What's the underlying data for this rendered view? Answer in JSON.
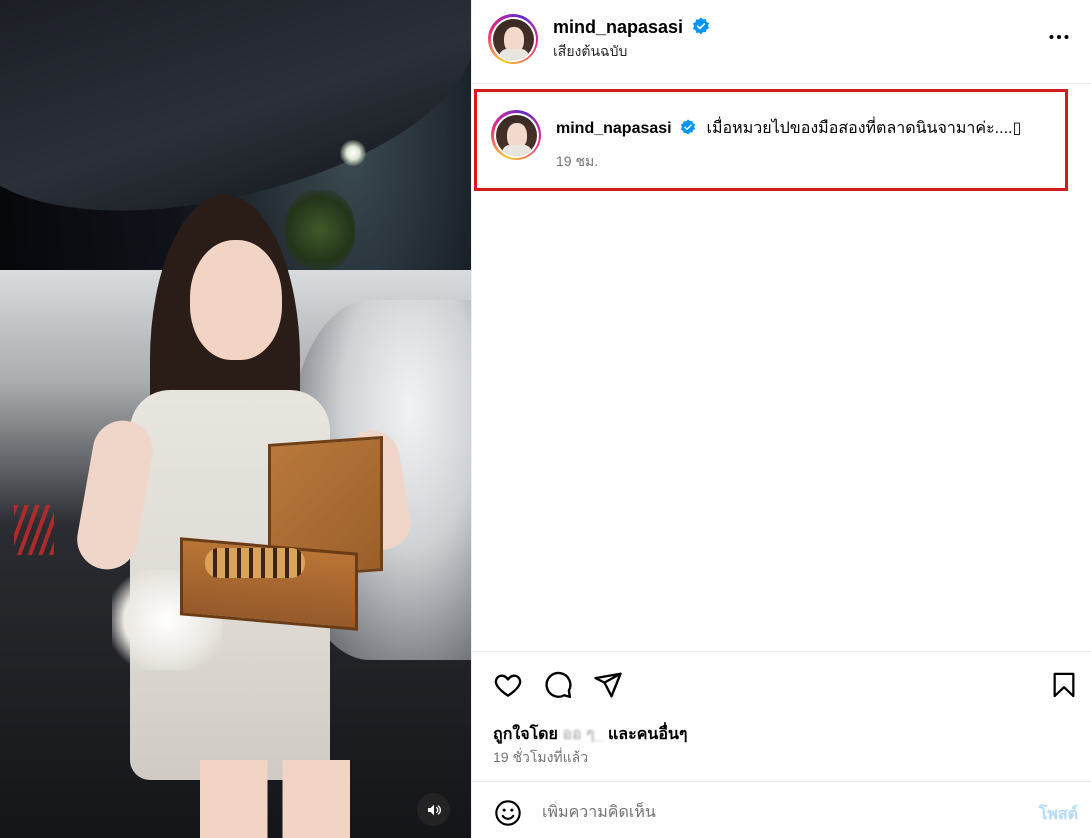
{
  "post": {
    "username": "mind_napasasi",
    "audio_label": "เสียงต้นฉบับ",
    "caption_username": "mind_napasasi",
    "caption_text": "เมื่อหมวยไปของมือสองที่ตลาดนินจามาค่ะ....▯",
    "caption_time": "19 ชม.",
    "liked_by_prefix": "ถูกใจโดย",
    "liked_by_name": "ออ ๆ_ ",
    "liked_by_suffix": "และคนอื่นๆ",
    "post_time": "19 ชั่วโมงที่แล้ว"
  },
  "comment": {
    "placeholder": "เพิ่มความคิดเห็น",
    "post_label": "โพสต์"
  },
  "colors": {
    "verified": "#0095f6",
    "highlight_border": "#d6191c",
    "post_button": "#b3dbff"
  },
  "icons": [
    "verified-badge-icon",
    "more-options-icon",
    "heart-icon",
    "comment-icon",
    "share-icon",
    "bookmark-icon",
    "emoji-icon",
    "sound-icon"
  ]
}
